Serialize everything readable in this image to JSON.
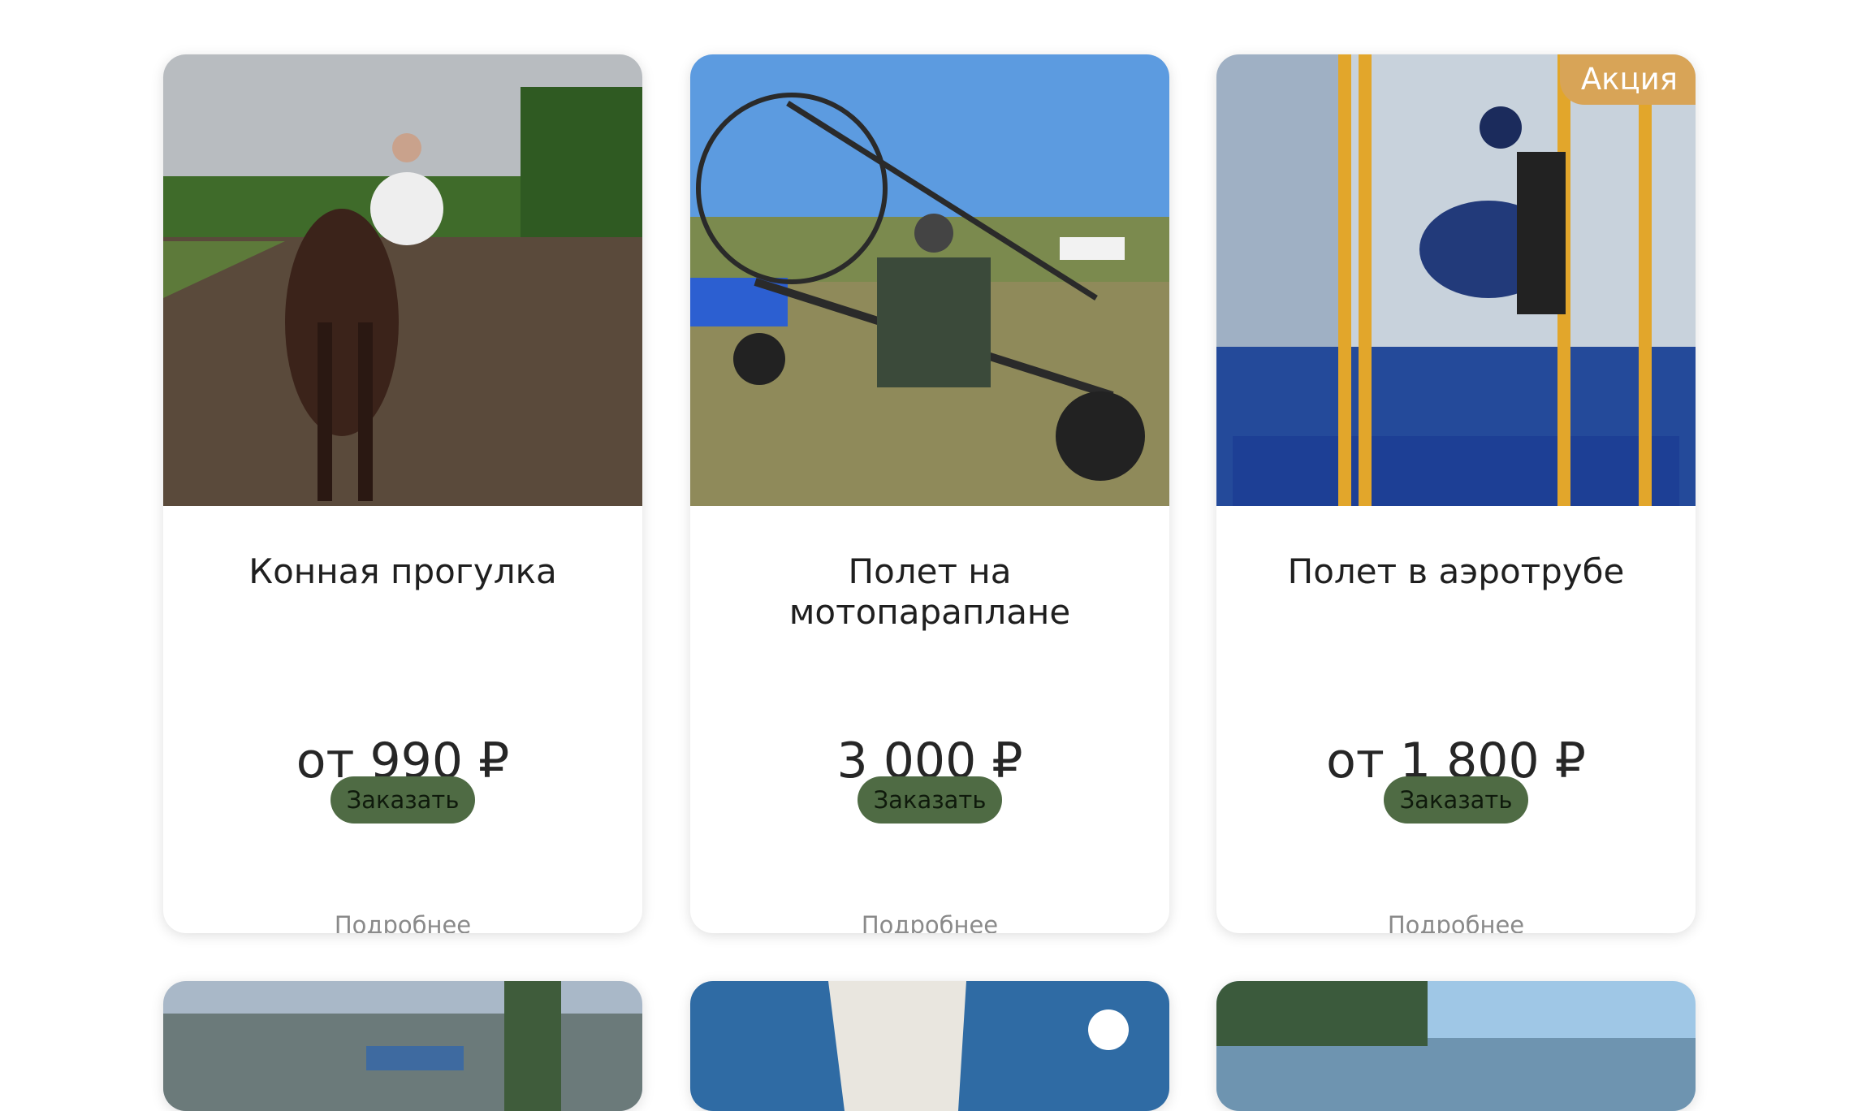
{
  "cards": [
    {
      "title": "Конная прогулка",
      "price": "от 990 ₽",
      "order_label": "Заказать",
      "more_label": "Подробнее",
      "image": "horse-ride-photo"
    },
    {
      "title": "Полет на мотопараплане",
      "price": "3 000 ₽",
      "order_label": "Заказать",
      "more_label": "Подробнее",
      "image": "paramotor-trike-photo"
    },
    {
      "title": "Полет в аэротрубе",
      "price": "от 1 800 ₽",
      "order_label": "Заказать",
      "more_label": "Подробнее",
      "badge": "Акция",
      "image": "wind-tunnel-photo"
    }
  ],
  "next_row_images": [
    "winter-park-photo",
    "sailboat-photo",
    "sea-view-photo"
  ],
  "colors": {
    "button_bg": "#4f6b44",
    "badge_bg": "#d8a457",
    "more_text": "#8a8a8a"
  }
}
